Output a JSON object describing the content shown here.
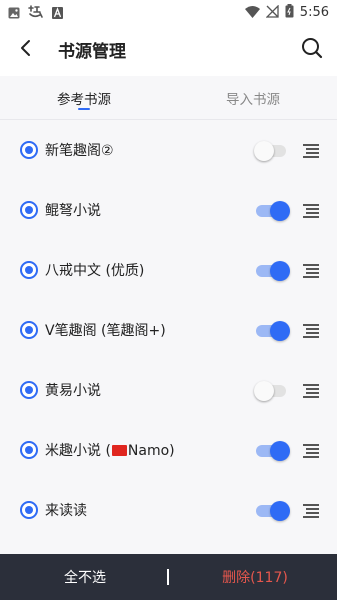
{
  "status_bar": {
    "time": "5:56",
    "left_icons": [
      "image-icon",
      "app-icon",
      "font-icon"
    ],
    "right_icons": [
      "wifi-icon",
      "no-signal-icon",
      "battery-icon"
    ]
  },
  "header": {
    "title": "书源管理",
    "back_icon": "back-arrow-icon",
    "search_icon": "search-icon"
  },
  "tabs": [
    {
      "label": "参考书源",
      "active": true
    },
    {
      "label": "导入书源",
      "active": false
    }
  ],
  "sources": [
    {
      "name": "新笔趣阁②",
      "enabled": false
    },
    {
      "name": "鲲弩小说",
      "enabled": true
    },
    {
      "name": "八戒中文 (优质)",
      "enabled": true
    },
    {
      "name": "V笔趣阁 (笔趣阁+)",
      "enabled": true
    },
    {
      "name": "黄易小说",
      "enabled": false
    },
    {
      "name": "米趣小说 (",
      "name_suffix": "Namo)",
      "flag": "red-flag-icon",
      "enabled": true
    },
    {
      "name": "来读读",
      "enabled": true
    }
  ],
  "bottom_bar": {
    "deselect_all": "全不选",
    "delete_label": "删除(117)"
  },
  "colors": {
    "accent": "#2f6bf5",
    "bottom_bar": "#2b2f3a",
    "delete": "#e5574d"
  }
}
